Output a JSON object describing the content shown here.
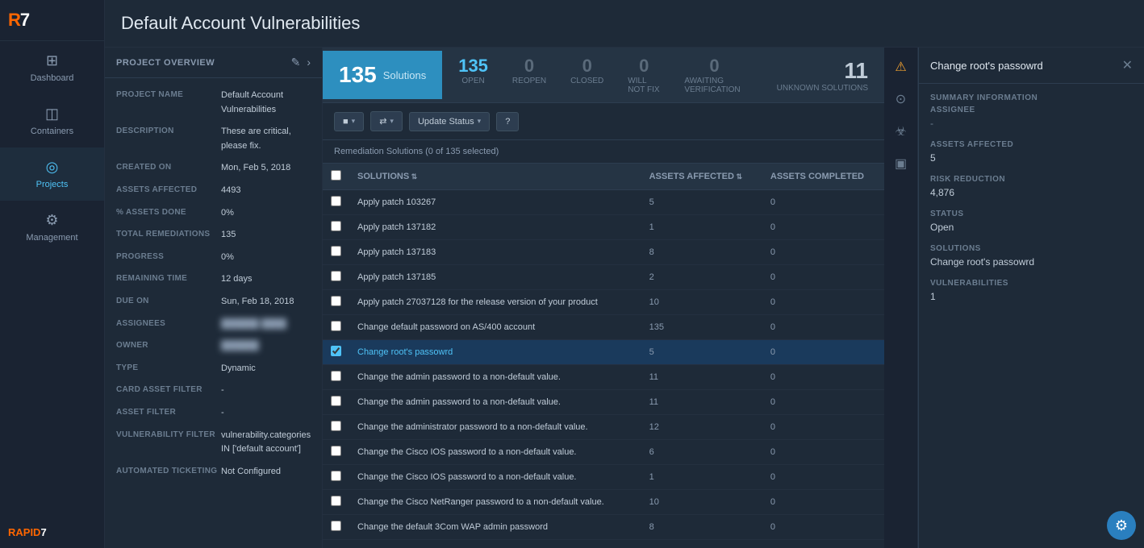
{
  "page": {
    "title": "Default Account Vulnerabilities"
  },
  "sidebar": {
    "items": [
      {
        "id": "dashboard",
        "label": "Dashboard",
        "icon": "⊞"
      },
      {
        "id": "containers",
        "label": "Containers",
        "icon": "◫"
      },
      {
        "id": "projects",
        "label": "Projects",
        "icon": "◎",
        "active": true
      },
      {
        "id": "management",
        "label": "Management",
        "icon": "⚙"
      }
    ],
    "logo": "RAPID7"
  },
  "project_overview": {
    "header": "PROJECT OVERVIEW",
    "edit_icon": "✎",
    "next_icon": "›",
    "fields": [
      {
        "label": "PROJECT NAME",
        "value": "Default Account Vulnerabilities"
      },
      {
        "label": "DESCRIPTION",
        "value": "These are critical, please fix."
      },
      {
        "label": "CREATED ON",
        "value": "Mon, Feb 5, 2018"
      },
      {
        "label": "ASSETS AFFECTED",
        "value": "4493"
      },
      {
        "label": "% ASSETS DONE",
        "value": "0%"
      },
      {
        "label": "TOTAL REMEDIATIONS",
        "value": "135"
      },
      {
        "label": "PROGRESS",
        "value": "0%"
      },
      {
        "label": "REMAINING TIME",
        "value": "12 days"
      },
      {
        "label": "DUE ON",
        "value": "Sun, Feb 18, 2018"
      },
      {
        "label": "ASSIGNEES",
        "value": "██████ ████",
        "blurred": true
      },
      {
        "label": "OWNER",
        "value": "██████",
        "blurred": true
      },
      {
        "label": "TYPE",
        "value": "Dynamic"
      },
      {
        "label": "CARD ASSET FILTER",
        "value": "-"
      },
      {
        "label": "ASSET FILTER",
        "value": "-"
      },
      {
        "label": "VULNERABILITY FILTER",
        "value": "vulnerability.categories IN ['default account']"
      },
      {
        "label": "AUTOMATED TICKETING",
        "value": "Not Configured"
      }
    ]
  },
  "stats": {
    "solutions_count": "135",
    "solutions_label": "Solutions",
    "items": [
      {
        "num": "135",
        "label": "Open",
        "zero": false
      },
      {
        "num": "0",
        "label": "Reopen",
        "zero": true
      },
      {
        "num": "0",
        "label": "Closed",
        "zero": true
      },
      {
        "num": "0",
        "label": "Will Not Fix",
        "zero": true
      },
      {
        "num": "0",
        "label": "Awaiting Verification",
        "zero": true
      }
    ],
    "unknown_num": "11",
    "unknown_label": "Unknown Solutions"
  },
  "toolbar": {
    "status_btn": "Update Status",
    "help_icon": "?",
    "color_btn": "■"
  },
  "remediation": {
    "header": "Remediation Solutions",
    "subheader": "(0 of 135 selected)",
    "columns": [
      {
        "label": "Solutions",
        "sortable": true
      },
      {
        "label": "Assets Affected",
        "sortable": true
      },
      {
        "label": "Assets Completed",
        "sortable": false
      }
    ],
    "rows": [
      {
        "name": "Apply patch 103267",
        "assets_affected": 5,
        "assets_completed": 0,
        "selected": false
      },
      {
        "name": "Apply patch 137182",
        "assets_affected": 1,
        "assets_completed": 0,
        "selected": false
      },
      {
        "name": "Apply patch 137183",
        "assets_affected": 8,
        "assets_completed": 0,
        "selected": false
      },
      {
        "name": "Apply patch 137185",
        "assets_affected": 2,
        "assets_completed": 0,
        "selected": false
      },
      {
        "name": "Apply patch 27037128 for the release version of your product",
        "assets_affected": 10,
        "assets_completed": 0,
        "selected": false
      },
      {
        "name": "Change default password on AS/400 account",
        "assets_affected": 135,
        "assets_completed": 0,
        "selected": false
      },
      {
        "name": "Change root's passowrd",
        "assets_affected": 5,
        "assets_completed": 0,
        "selected": true
      },
      {
        "name": "Change the admin password to a non-default value.",
        "assets_affected": 11,
        "assets_completed": 0,
        "selected": false
      },
      {
        "name": "Change the admin password to a non-default value.",
        "assets_affected": 11,
        "assets_completed": 0,
        "selected": false
      },
      {
        "name": "Change the administrator password to a non-default value.",
        "assets_affected": 12,
        "assets_completed": 0,
        "selected": false
      },
      {
        "name": "Change the Cisco IOS password to a non-default value.",
        "assets_affected": 6,
        "assets_completed": 0,
        "selected": false
      },
      {
        "name": "Change the Cisco IOS password to a non-default value.",
        "assets_affected": 1,
        "assets_completed": 0,
        "selected": false
      },
      {
        "name": "Change the Cisco NetRanger password to a non-default value.",
        "assets_affected": 10,
        "assets_completed": 0,
        "selected": false
      },
      {
        "name": "Change the default 3Com WAP admin password",
        "assets_affected": 8,
        "assets_completed": 0,
        "selected": false
      }
    ]
  },
  "side_icons": [
    {
      "id": "alert",
      "icon": "⚠",
      "active": true
    },
    {
      "id": "search-circle",
      "icon": "⊙"
    },
    {
      "id": "bug",
      "icon": "☣"
    },
    {
      "id": "monitor",
      "icon": "⬛"
    }
  ],
  "detail_panel": {
    "title": "Change root's passowrd",
    "close_icon": "✕",
    "summary_title": "SUMMARY INFORMATION",
    "sections": [
      {
        "label": "ASSIGNEE",
        "value": "-"
      },
      {
        "label": "ASSETS AFFECTED",
        "value": "5"
      },
      {
        "label": "RISK REDUCTION",
        "value": "4,876"
      },
      {
        "label": "STATUS",
        "value": "Open"
      },
      {
        "label": "SOLUTIONS",
        "value": "Change root's passowrd"
      },
      {
        "label": "VULNERABILITIES",
        "value": "1"
      }
    ]
  },
  "bottom_gear": "⚙"
}
